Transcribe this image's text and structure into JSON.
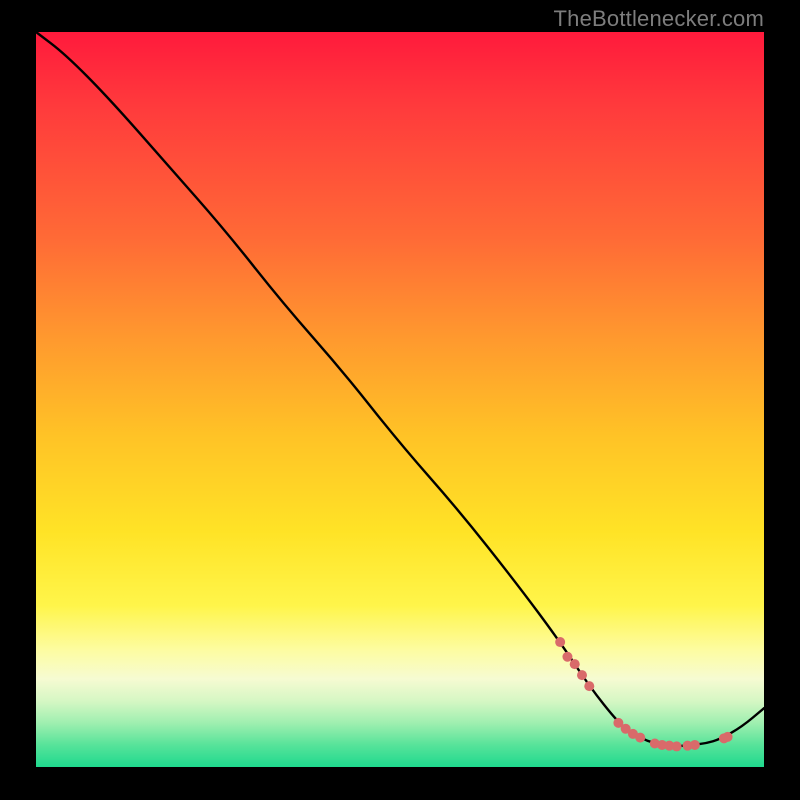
{
  "watermark": "TheBottlenecker.com",
  "colors": {
    "background": "#000000",
    "curve": "#000000",
    "marker": "#d96a6a",
    "gradient_top": "#ff1a3c",
    "gradient_bottom": "#1fd98e"
  },
  "chart_data": {
    "type": "line",
    "title": "",
    "xlabel": "",
    "ylabel": "",
    "xlim": [
      0,
      100
    ],
    "ylim": [
      0,
      100
    ],
    "x": [
      0,
      4,
      10,
      18,
      26,
      34,
      42,
      50,
      58,
      66,
      72,
      76,
      80,
      82,
      84,
      86,
      88,
      90,
      92,
      94,
      97,
      100
    ],
    "values": [
      100,
      97,
      91,
      82,
      73,
      63,
      54,
      44,
      35,
      25,
      17,
      11,
      6,
      4.5,
      3.5,
      3,
      2.8,
      3,
      3.2,
      3.8,
      5.5,
      8
    ],
    "markers": {
      "comment": "dashed pink marker positions along the curve (x,y pairs)",
      "points": [
        [
          72,
          17
        ],
        [
          73,
          15
        ],
        [
          74,
          14
        ],
        [
          75,
          12.5
        ],
        [
          76,
          11
        ],
        [
          80,
          6
        ],
        [
          81,
          5.2
        ],
        [
          82,
          4.5
        ],
        [
          83,
          4
        ],
        [
          85,
          3.2
        ],
        [
          86,
          3
        ],
        [
          87,
          2.9
        ],
        [
          88,
          2.8
        ],
        [
          89.5,
          2.9
        ],
        [
          90.5,
          3
        ],
        [
          94.5,
          3.9
        ],
        [
          95,
          4.1
        ]
      ]
    }
  }
}
